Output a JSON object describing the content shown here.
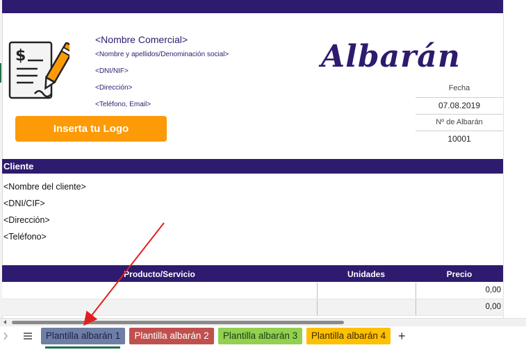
{
  "company": {
    "name": "<Nombre Comercial>",
    "legal_name": "<Nombre y apellidos/Denominación social>",
    "tax_id": "<DNI/NIF>",
    "address": "<Dirección>",
    "contact": "<Teléfono, Email>"
  },
  "document": {
    "title": "Albarán",
    "date_label": "Fecha",
    "date_value": "07.08.2019",
    "number_label": "Nº de Albarán",
    "number_value": "10001"
  },
  "logo_button": {
    "label": "Inserta tu Logo"
  },
  "client": {
    "section_title": "Cliente",
    "name": "<Nombre del cliente>",
    "tax_id": "<DNI/CIF>",
    "address": "<Dirección>",
    "phone": "<Teléfono>"
  },
  "table": {
    "headers": [
      "Producto/Servicio",
      "Unidades",
      "Precio"
    ],
    "rows": [
      {
        "product": "",
        "units": "",
        "price": "0,00"
      },
      {
        "product": "",
        "units": "",
        "price": "0,00"
      }
    ]
  },
  "sheet_tabs": [
    {
      "label": "Plantilla albarán 1",
      "color": "#6f7ea6",
      "active": true
    },
    {
      "label": "Plantilla albarán 2",
      "color": "#c0504d",
      "active": false
    },
    {
      "label": "Plantilla albarán 3",
      "color": "#92d050",
      "active": false
    },
    {
      "label": "Plantilla albarán 4",
      "color": "#ffc000",
      "active": false
    }
  ],
  "colors": {
    "brand": "#2e1a6e",
    "accent": "#fc9a08",
    "annotation_arrow": "#e02020"
  },
  "icons": [
    "invoice-pen-icon",
    "chevron-right-icon",
    "menu-icon",
    "plus-icon"
  ]
}
